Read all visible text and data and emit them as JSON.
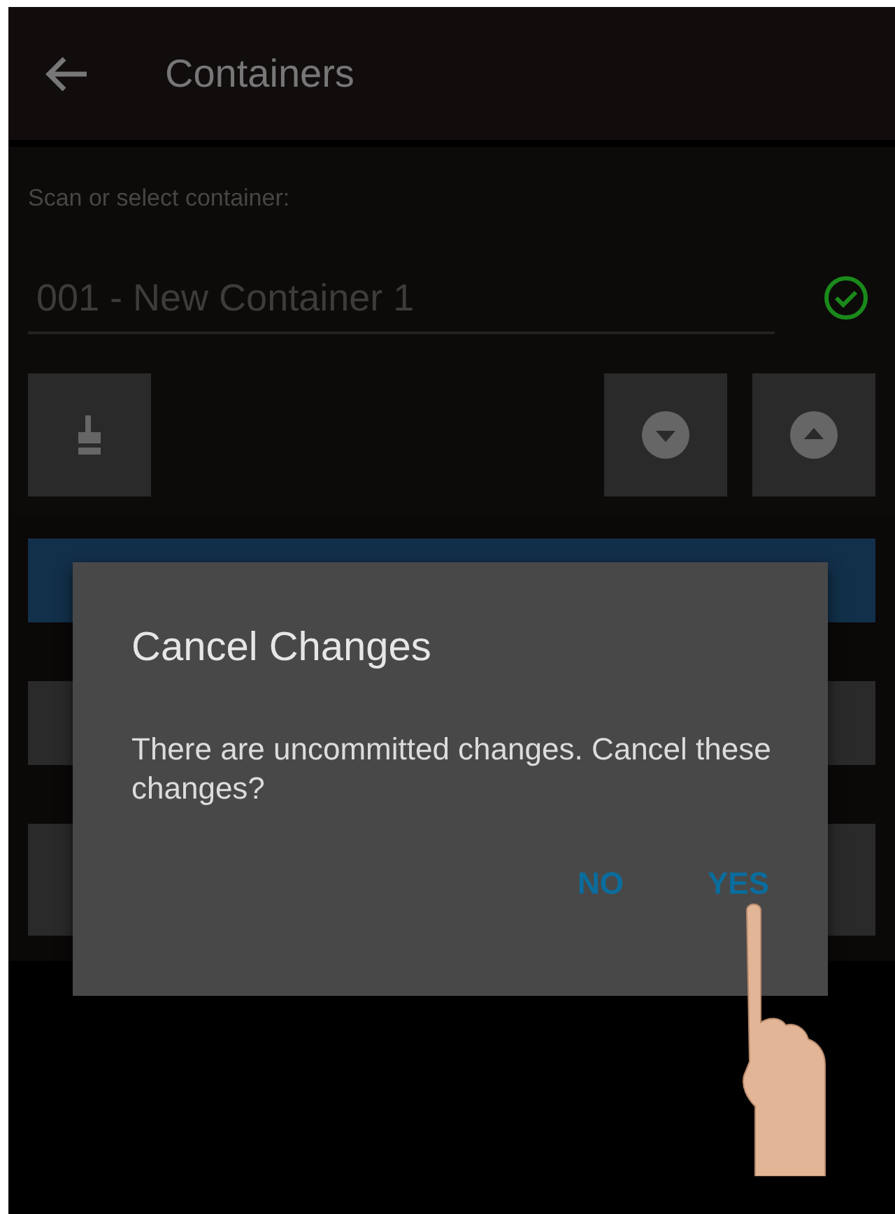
{
  "header": {
    "title": "Containers"
  },
  "container_field": {
    "label": "Scan or select container:",
    "value": "001 - New Container 1",
    "valid": true
  },
  "list": [
    {
      "selected": true
    },
    {
      "selected": false
    },
    {
      "selected": false
    }
  ],
  "dialog": {
    "title": "Cancel Changes",
    "message": "There are uncommitted changes. Cancel these changes?",
    "buttons": [
      "NO",
      "YES"
    ]
  }
}
